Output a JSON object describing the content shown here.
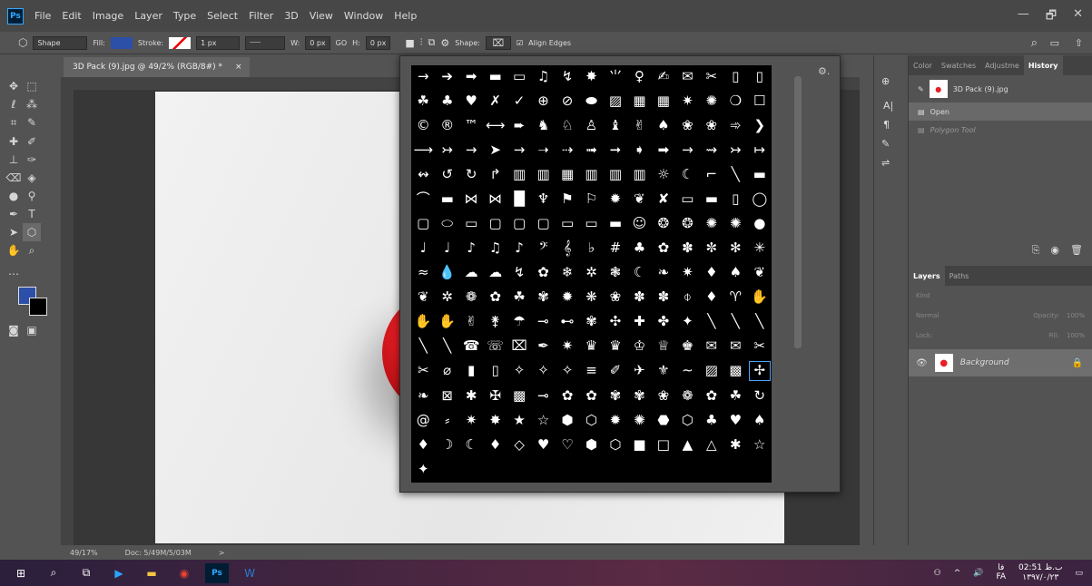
{
  "menubar": {
    "logo": "Ps",
    "items": [
      "File",
      "Edit",
      "Image",
      "Layer",
      "Type",
      "Select",
      "Filter",
      "3D",
      "View",
      "Window",
      "Help"
    ],
    "window_controls": [
      "—",
      "🗗",
      "✕"
    ]
  },
  "options": {
    "mode": "Shape",
    "fill_label": "Fill:",
    "stroke_label": "Stroke:",
    "stroke_width": "1 px",
    "w_label": "W:",
    "w_value": "0 px",
    "link": "GO",
    "h_label": "H:",
    "h_value": "0 px",
    "shape_label": "Shape:",
    "align_edges": "Align Edges",
    "fill_color": "#2c4fa8"
  },
  "document": {
    "tab_title": "3D Pack (9).jpg @ 49/2% (RGB/8#) *",
    "tab_close": "×",
    "zoom": "49/17%",
    "doc_info": "Doc: 5/49M/5/03M",
    "arrow": ">"
  },
  "picker": {
    "gear": "⚙.",
    "shapes": [
      "→",
      "➔",
      "➡",
      "▬",
      "▭",
      "♫",
      "↯",
      "✸",
      "⺌",
      "♀",
      "✍",
      "✉",
      "✂",
      "▯",
      "▯",
      "☘",
      "♣",
      "♥",
      "✗",
      "✓",
      "⊕",
      "⊘",
      "⬬",
      "▨",
      "▦",
      "▦",
      "✷",
      "✺",
      "❍",
      "☐",
      "©",
      "®",
      "™",
      "⟷",
      "➨",
      "♞",
      "♘",
      "♙",
      "♝",
      "✌",
      "♠",
      "❀",
      "❀",
      "➾",
      "❯",
      "⟶",
      "↣",
      "→",
      "➤",
      "→",
      "➝",
      "⇢",
      "➟",
      "➞",
      "➧",
      "➡",
      "→",
      "⇝",
      "↣",
      "↦",
      "↭",
      "↺",
      "↻",
      "↱",
      "▥",
      "▥",
      "▦",
      "▥",
      "▥",
      "▥",
      "☼",
      "☾",
      "⌐",
      "╲",
      "▬",
      "⌒",
      "▬",
      "⋈",
      "⋈",
      "█",
      "♆",
      "⚑",
      "⚐",
      "✹",
      "❦",
      "✘",
      "▭",
      "▬",
      "▯",
      "◯",
      "▢",
      "⬭",
      "▭",
      "▢",
      "▢",
      "▢",
      "▭",
      "▭",
      "▬",
      "☺",
      "❂",
      "❂",
      "✺",
      "✺",
      "●",
      "♩",
      "♩",
      "♪",
      "♫",
      "♪",
      "𝄢",
      "𝄞",
      "♭",
      "#",
      "♣",
      "✿",
      "✽",
      "✼",
      "✻",
      "✳",
      "≈",
      "💧",
      "☁",
      "☁",
      "↯",
      "✿",
      "❄",
      "✲",
      "❃",
      "☾",
      "❧",
      "✷",
      "♦",
      "♠",
      "❦",
      "❦",
      "✲",
      "❁",
      "✿",
      "☘",
      "✾",
      "✹",
      "❋",
      "❀",
      "✽",
      "✽",
      "⌽",
      "♦",
      "♈",
      "✋",
      "✋",
      "✋",
      "✌",
      "⚵",
      "☂",
      "⊸",
      "⊷",
      "✾",
      "✣",
      "✚",
      "✤",
      "✦",
      "╲",
      "╲",
      "╲",
      "╲",
      "╲",
      "☎",
      "☏",
      "⌧",
      "✒",
      "✷",
      "♛",
      "♛",
      "♔",
      "♕",
      "♚",
      "✉",
      "✉",
      "✂",
      "✂",
      "⌀",
      "▮",
      "▯",
      "✧",
      "✧",
      "✧",
      "≡",
      "✐",
      "✈",
      "⚜",
      "∼",
      "▨",
      "▩",
      "✢",
      "❧",
      "⊠",
      "✱",
      "✠",
      "▩",
      "⊸",
      "✿",
      "✿",
      "✾",
      "✾",
      "❀",
      "❁",
      "✿",
      "☘",
      "↻",
      "@",
      "⸗",
      "✷",
      "✸",
      "★",
      "☆",
      "⬢",
      "⬡",
      "✹",
      "✺",
      "⬣",
      "⬡",
      "♣",
      "♥",
      "♠",
      "♦",
      "☽",
      "☾",
      "♦",
      "◇",
      "♥",
      "♡",
      "⬢",
      "⬡",
      "■",
      "□",
      "▲",
      "△",
      "✱",
      "☆",
      "✦"
    ],
    "selected_index": 194
  },
  "right_panel": {
    "top_tabs": [
      "Color",
      "Swatches",
      "Adjustme",
      "History"
    ],
    "history_source": "3D Pack (9).jpg",
    "history_items": [
      "Open",
      "Polygon Tool"
    ],
    "layer_tabs": [
      "Layers",
      "Paths"
    ],
    "kind_label": "Kind",
    "blend_mode": "Normal",
    "opacity_label": "Opacity:",
    "opacity_value": "100%",
    "lock_label": "Lock:",
    "fill_label": "Fill:",
    "fill_value": "100%",
    "layer_name": "Background"
  },
  "taskbar": {
    "time": "02:51 ب.ظ",
    "date": "۱۳۹۷/۰/۲۳",
    "lang": "FA",
    "lang_short": "فا"
  },
  "chart_colors": {
    "accent": "#31a8ff",
    "cherry": "#e91f26",
    "stem": "#3ea33e"
  }
}
